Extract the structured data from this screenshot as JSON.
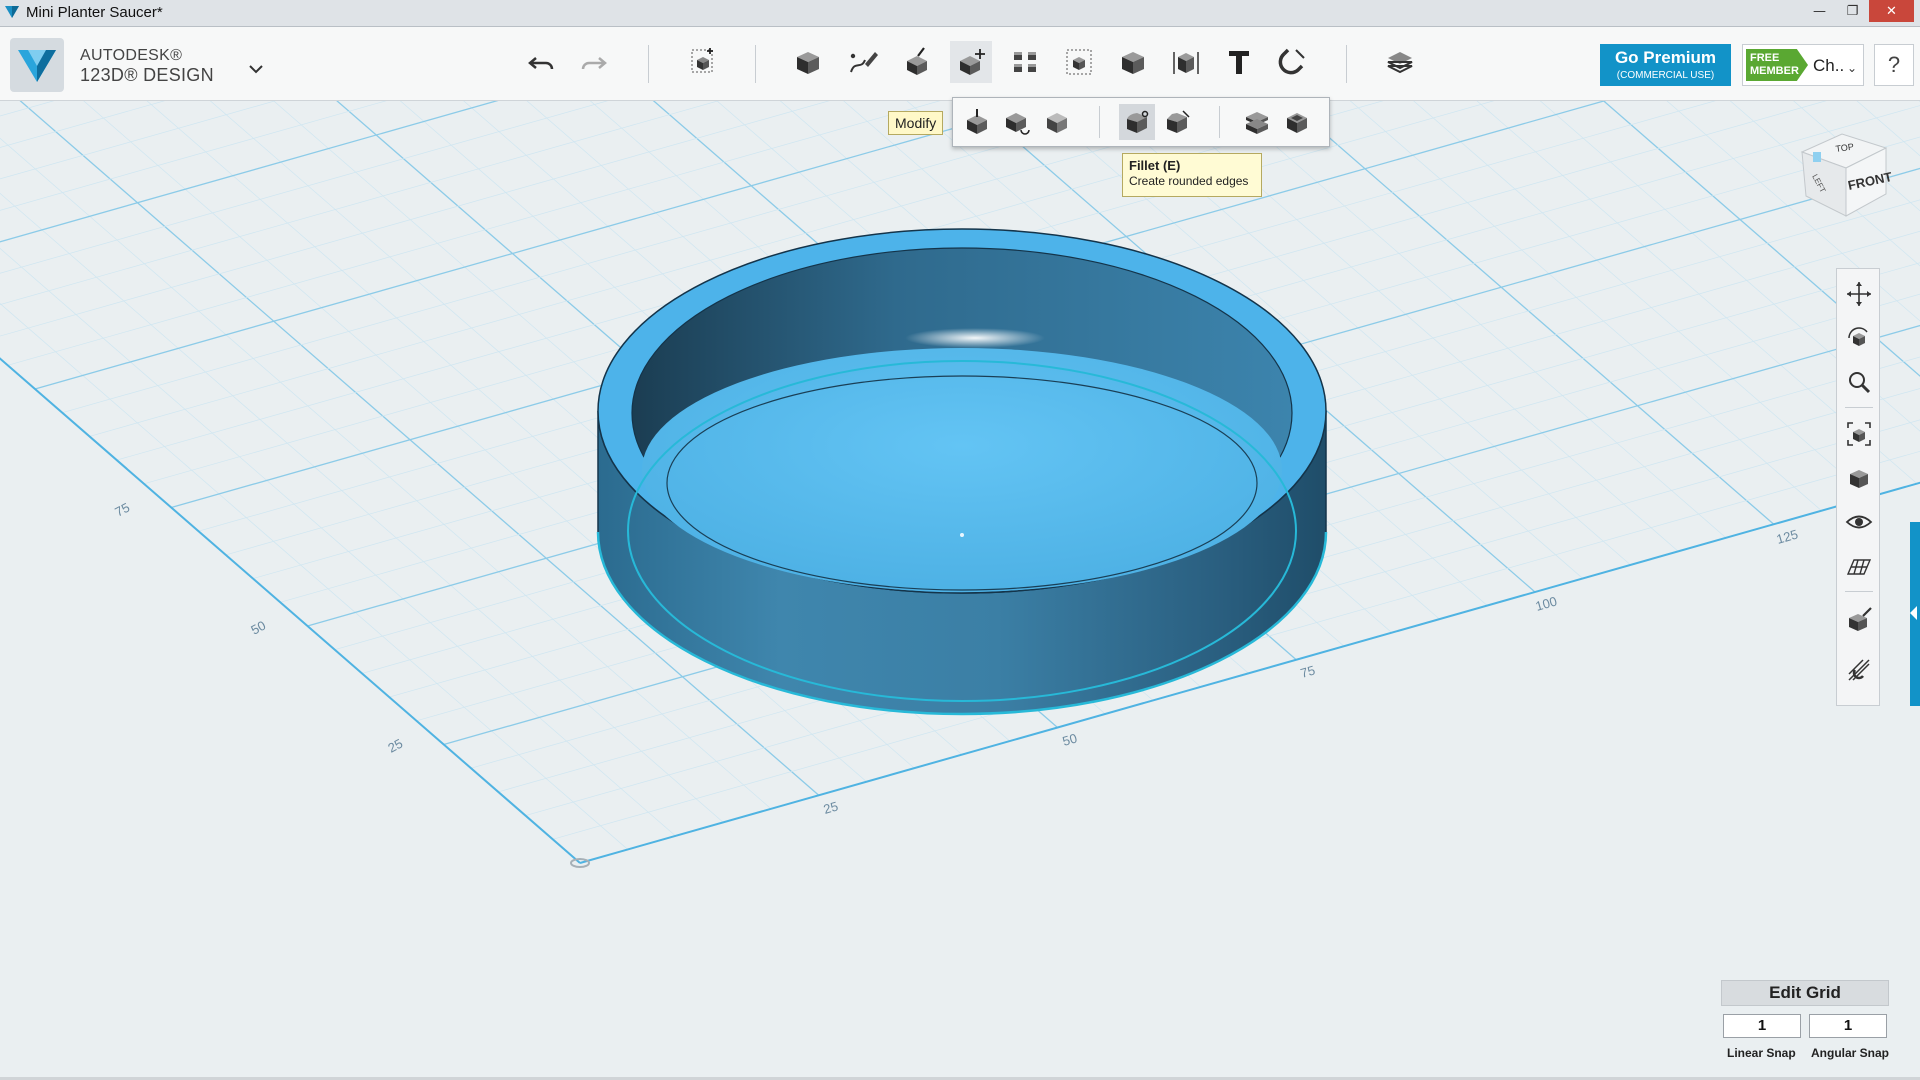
{
  "window": {
    "title": "Mini Planter Saucer*",
    "buttons": {
      "minimize": "—",
      "maximize": "❐",
      "close": "✕"
    }
  },
  "brand": {
    "line1": "AUTODESK®",
    "line2": "123D® DESIGN"
  },
  "toolbar": {
    "tools": [
      {
        "name": "undo-button",
        "icon": "undo-icon"
      },
      {
        "name": "redo-button",
        "icon": "redo-icon"
      },
      {
        "name": "transform-button",
        "icon": "transform-icon"
      },
      {
        "name": "primitives-button",
        "icon": "primitives-icon"
      },
      {
        "name": "sketch-button",
        "icon": "sketch-icon"
      },
      {
        "name": "construct-button",
        "icon": "construct-icon"
      },
      {
        "name": "modify-button",
        "icon": "modify-icon"
      },
      {
        "name": "pattern-button",
        "icon": "pattern-icon"
      },
      {
        "name": "grouping-button",
        "icon": "grouping-icon"
      },
      {
        "name": "combine-button",
        "icon": "combine-icon"
      },
      {
        "name": "measure-button",
        "icon": "measure-icon"
      },
      {
        "name": "text-button",
        "icon": "text-icon"
      },
      {
        "name": "snap-button",
        "icon": "snap-icon"
      },
      {
        "name": "material-button",
        "icon": "material-icon"
      }
    ]
  },
  "account": {
    "premium_line1": "Go Premium",
    "premium_line2": "(COMMERCIAL USE)",
    "badge_line1": "FREE",
    "badge_line2": "MEMBER",
    "user": "Ch..",
    "help": "?"
  },
  "flyout": {
    "label": "Modify",
    "tools": [
      "press-pull",
      "tweak",
      "split-face",
      "fillet",
      "chamfer",
      "split-solid",
      "shell"
    ]
  },
  "tooltip": {
    "title": "Fillet (E)",
    "description": "Create rounded edges"
  },
  "viewcube": {
    "top": "TOP",
    "left": "LEFT",
    "front": "FRONT"
  },
  "navigation": [
    "pan-icon",
    "orbit-icon",
    "zoom-icon",
    "fit-icon",
    "view-mode-icon",
    "visibility-icon",
    "grid-icon",
    "material-icon",
    "snap-icon"
  ],
  "grid_labels": {
    "left_axis": [
      "75",
      "50",
      "25"
    ],
    "right_axis": [
      "25",
      "50",
      "75",
      "100",
      "125"
    ]
  },
  "edit_grid": {
    "button": "Edit Grid",
    "linear_value": "1",
    "angular_value": "1",
    "linear_label": "Linear Snap",
    "angular_label": "Angular Snap"
  },
  "colors": {
    "accent": "#1293c8",
    "model": "#5bbcf0",
    "model_dark": "#2e6f93",
    "grid": "#9fd2ea",
    "grid_axis": "#4fb3e2",
    "background": "#eaeff1"
  }
}
